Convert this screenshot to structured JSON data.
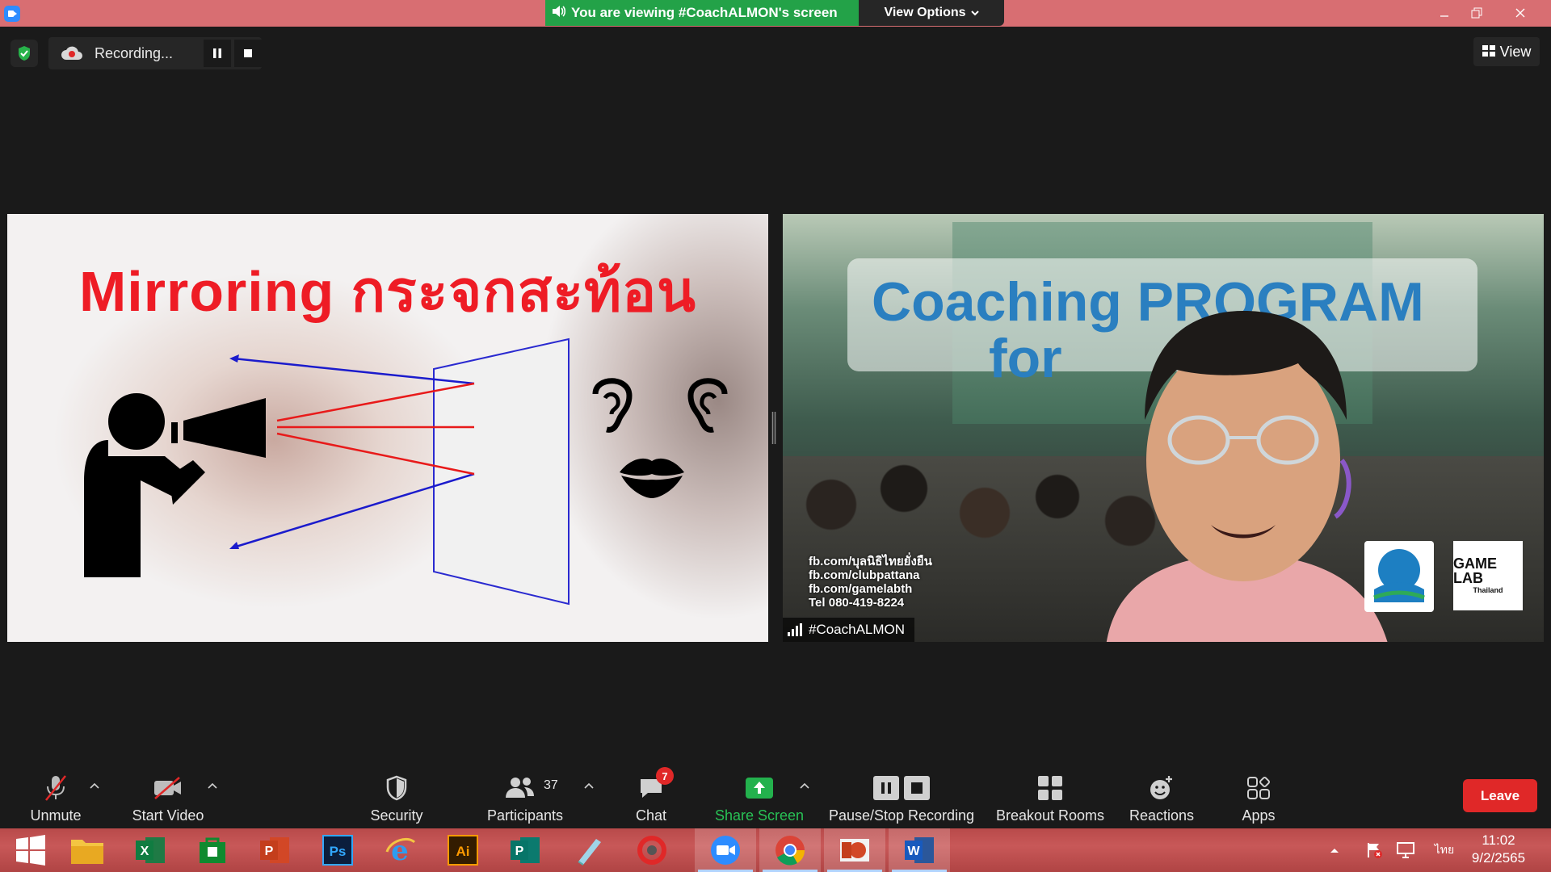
{
  "titlebar": {
    "viewing_text": "You are viewing #CoachALMON's screen",
    "view_options_label": "View Options",
    "window_controls": [
      "minimize",
      "restore",
      "close"
    ]
  },
  "recording": {
    "status_label": "Recording...",
    "pause_icon": "pause-icon",
    "stop_icon": "stop-icon"
  },
  "view_button": {
    "label": "View"
  },
  "shared_screen": {
    "title": "Mirroring กระจกสะท้อน"
  },
  "video": {
    "banner_line1": "Coaching PROGRAM",
    "banner_line2": "for",
    "contact_lines": [
      "fb.com/บุลนิธิไทยยั่งยืน",
      "fb.com/clubpattana",
      "fb.com/gamelabth",
      "Tel 080-419-8224"
    ],
    "logo_text": "GAME LAB",
    "logo_sub": "Thailand",
    "participant_name": "#CoachALMON"
  },
  "toolbar": {
    "unmute": "Unmute",
    "start_video": "Start Video",
    "security": "Security",
    "participants": "Participants",
    "participants_count": "37",
    "chat": "Chat",
    "chat_badge": "7",
    "share_screen": "Share Screen",
    "pause_stop_recording": "Pause/Stop Recording",
    "breakout_rooms": "Breakout Rooms",
    "reactions": "Reactions",
    "apps": "Apps",
    "leave": "Leave"
  },
  "colors": {
    "share_green": "#23a248",
    "leave_red": "#e02828",
    "title_red": "#ee1c25",
    "banner_blue": "#2a7fc0"
  },
  "taskbar": {
    "apps": [
      "windows-start",
      "file-explorer",
      "excel",
      "store",
      "powerpoint",
      "photoshop",
      "internet-explorer",
      "illustrator",
      "publisher",
      "notepad",
      "photoscape",
      "zoom",
      "chrome",
      "powerpoint-viewer",
      "word"
    ],
    "language": "ไทย",
    "time": "11:02",
    "date": "9/2/2565"
  }
}
